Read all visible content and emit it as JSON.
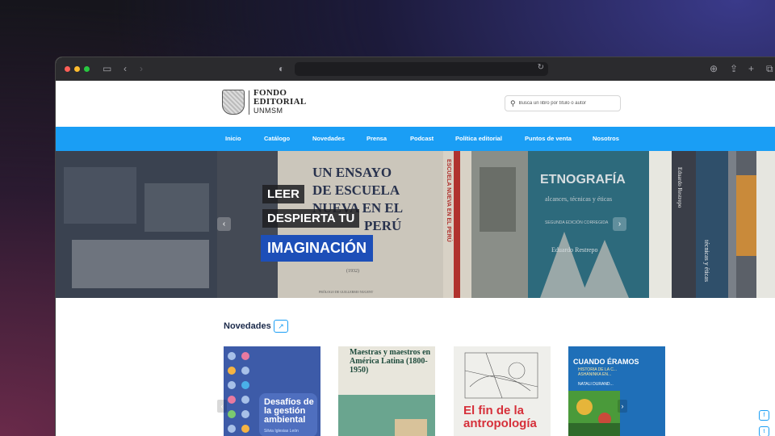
{
  "browser": {
    "back_icon": "chevron-left",
    "forward_icon": "chevron-right",
    "sidebar_icon": "sidebar",
    "shield_icon": "shield",
    "reload_icon": "reload",
    "download_icon": "download",
    "share_icon": "share",
    "newtab_icon": "plus",
    "tabs_icon": "tabs"
  },
  "header": {
    "logo": {
      "line1": "FONDO",
      "line2": "EDITORIAL",
      "line3": "UNMSM"
    },
    "search_placeholder": "Busca un libro por título o autor"
  },
  "nav": {
    "items": [
      {
        "label": "Inicio"
      },
      {
        "label": "Catálogo"
      },
      {
        "label": "Novedades"
      },
      {
        "label": "Prensa"
      },
      {
        "label": "Podcast"
      },
      {
        "label": "Política editorial"
      },
      {
        "label": "Puntos de venta"
      },
      {
        "label": "Nosotros"
      }
    ]
  },
  "hero": {
    "line1": "LEER",
    "line2": "DESPIERTA TU",
    "line3": "IMAGINACIÓN",
    "book_center_text": [
      "UN ENSAYO",
      "DE ESCUELA",
      "NUEVA EN EL",
      "PERÚ"
    ],
    "book_spine_text": "ESCUELA NUEVA EN EL PERÚ",
    "book_right_title": "ETNOGRAFÍA",
    "book_right_subtitle": "alcances, técnicas y éticas",
    "book_right_author": "Eduardo Restrepo",
    "book_right_edition": "SEGUNDA EDICIÓN CORREGIDA",
    "book_center_date": "(1932)",
    "book_center_prologue": "PRÓLOGO DE GUILLERMO NUGENT",
    "book_spine_author": "Eduardo Restrepo",
    "book_spine_title": "técnicas y éticas"
  },
  "novedades": {
    "title": "Novedades",
    "books": [
      {
        "title": "Desafíos de la gestión ambiental",
        "author": "Silvia Iglesias León"
      },
      {
        "title": "Maestras y maestros en América Latina (1800-1950)"
      },
      {
        "title": "El fin de la antropología"
      },
      {
        "title": "CUANDO ÉRAMOS",
        "subtitle": "HISTORIA DE LA C... ASHÁNINKA EN...",
        "author": "NATALI DURAND..."
      }
    ]
  },
  "social": {
    "facebook": "f",
    "twitter": "t"
  },
  "colors": {
    "nav_blue": "#1a9ef5",
    "hero_blue": "#1d4fb8",
    "title_navy": "#1b2a4a"
  }
}
